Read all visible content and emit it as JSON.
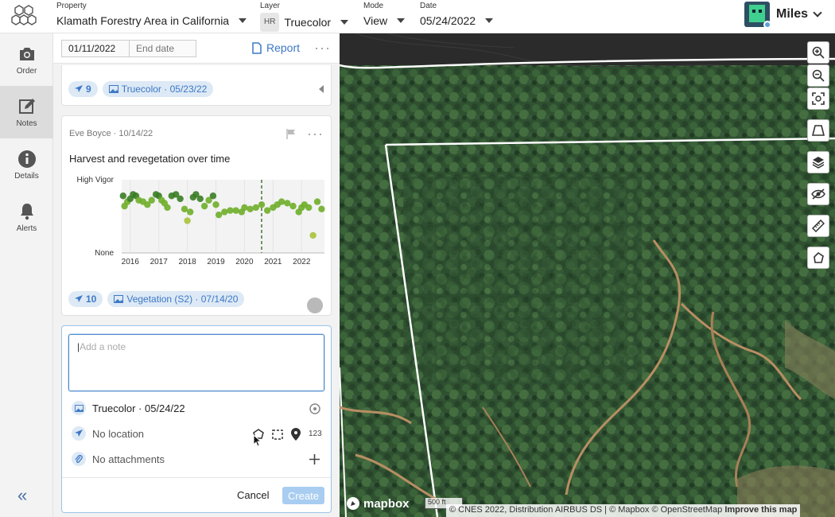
{
  "topbar": {
    "property": {
      "label": "Property",
      "value": "Klamath Forestry Area in California"
    },
    "layer": {
      "label": "Layer",
      "badge": "HR",
      "value": "Truecolor"
    },
    "mode": {
      "label": "Mode",
      "value": "View"
    },
    "date": {
      "label": "Date",
      "value": "05/24/2022"
    },
    "user": {
      "name": "Miles"
    }
  },
  "leftnav": {
    "items": [
      {
        "label": "Order",
        "icon": "camera-icon"
      },
      {
        "label": "Notes",
        "icon": "edit-note-icon",
        "active": true
      },
      {
        "label": "Details",
        "icon": "info-icon"
      },
      {
        "label": "Alerts",
        "icon": "bell-icon"
      }
    ],
    "collapse": "«"
  },
  "panel": {
    "start_date": "01/11/2022",
    "end_date_placeholder": "End date",
    "report_label": "Report",
    "prev_card": {
      "count": "9",
      "image": "Truecolor · 05/23/22"
    },
    "note_card": {
      "author": "Eve Boyce · 10/14/22",
      "title": "Harvest and revegetation over time",
      "count": "10",
      "image": "Vegetation (S2) · 07/14/20"
    },
    "editor": {
      "placeholder": "Add a note",
      "image": "Truecolor · 05/24/22",
      "location": "No location",
      "location_count": "123",
      "attachments": "No attachments",
      "cancel": "Cancel",
      "create": "Create"
    }
  },
  "chart_data": {
    "type": "scatter",
    "title": "",
    "xlabel": "",
    "ylabel": "",
    "y_ticks": [
      "High Vigor",
      "None"
    ],
    "x_ticks": [
      "2016",
      "2017",
      "2018",
      "2019",
      "2020",
      "2021",
      "2022"
    ],
    "xlim": [
      2015.7,
      2022.8
    ],
    "ylim": [
      0,
      1
    ],
    "marker_line": 2020.6,
    "series": [
      {
        "x": [
          2015.75,
          2015.8,
          2015.9,
          2016.0,
          2016.1,
          2016.2,
          2016.3,
          2016.45,
          2016.6,
          2016.75,
          2016.9,
          2017.0,
          2017.1,
          2017.2,
          2017.3,
          2017.45,
          2017.6,
          2017.75,
          2017.9,
          2018.0,
          2018.1,
          2018.2,
          2018.3,
          2018.45,
          2018.6,
          2018.75,
          2018.9,
          2019.0,
          2019.1,
          2019.3,
          2019.5,
          2019.7,
          2019.9,
          2020.0,
          2020.2,
          2020.4,
          2020.6,
          2020.8,
          2021.0,
          2021.15,
          2021.3,
          2021.5,
          2021.7,
          2021.9,
          2022.0,
          2022.1,
          2022.25,
          2022.4,
          2022.55,
          2022.7
        ],
        "y": [
          0.78,
          0.64,
          0.7,
          0.74,
          0.8,
          0.78,
          0.72,
          0.7,
          0.66,
          0.72,
          0.8,
          0.78,
          0.72,
          0.68,
          0.62,
          0.78,
          0.8,
          0.74,
          0.6,
          0.44,
          0.56,
          0.76,
          0.8,
          0.74,
          0.64,
          0.72,
          0.78,
          0.66,
          0.52,
          0.56,
          0.58,
          0.58,
          0.56,
          0.62,
          0.6,
          0.62,
          0.66,
          0.58,
          0.62,
          0.66,
          0.7,
          0.68,
          0.64,
          0.56,
          0.62,
          0.66,
          0.62,
          0.24,
          0.7,
          0.6
        ]
      }
    ]
  },
  "map": {
    "logo": "mapbox",
    "scale": "500 ft",
    "attribution": "© CNES 2022, Distribution AIRBUS DS | © Mapbox © OpenStreetMap",
    "improve": "Improve this map",
    "controls": [
      "zoom-in-icon",
      "zoom-out-icon",
      "fit-bounds-icon",
      "perspective-icon",
      "layers-icon",
      "hide-icon",
      "ruler-icon",
      "polygon-icon"
    ]
  }
}
